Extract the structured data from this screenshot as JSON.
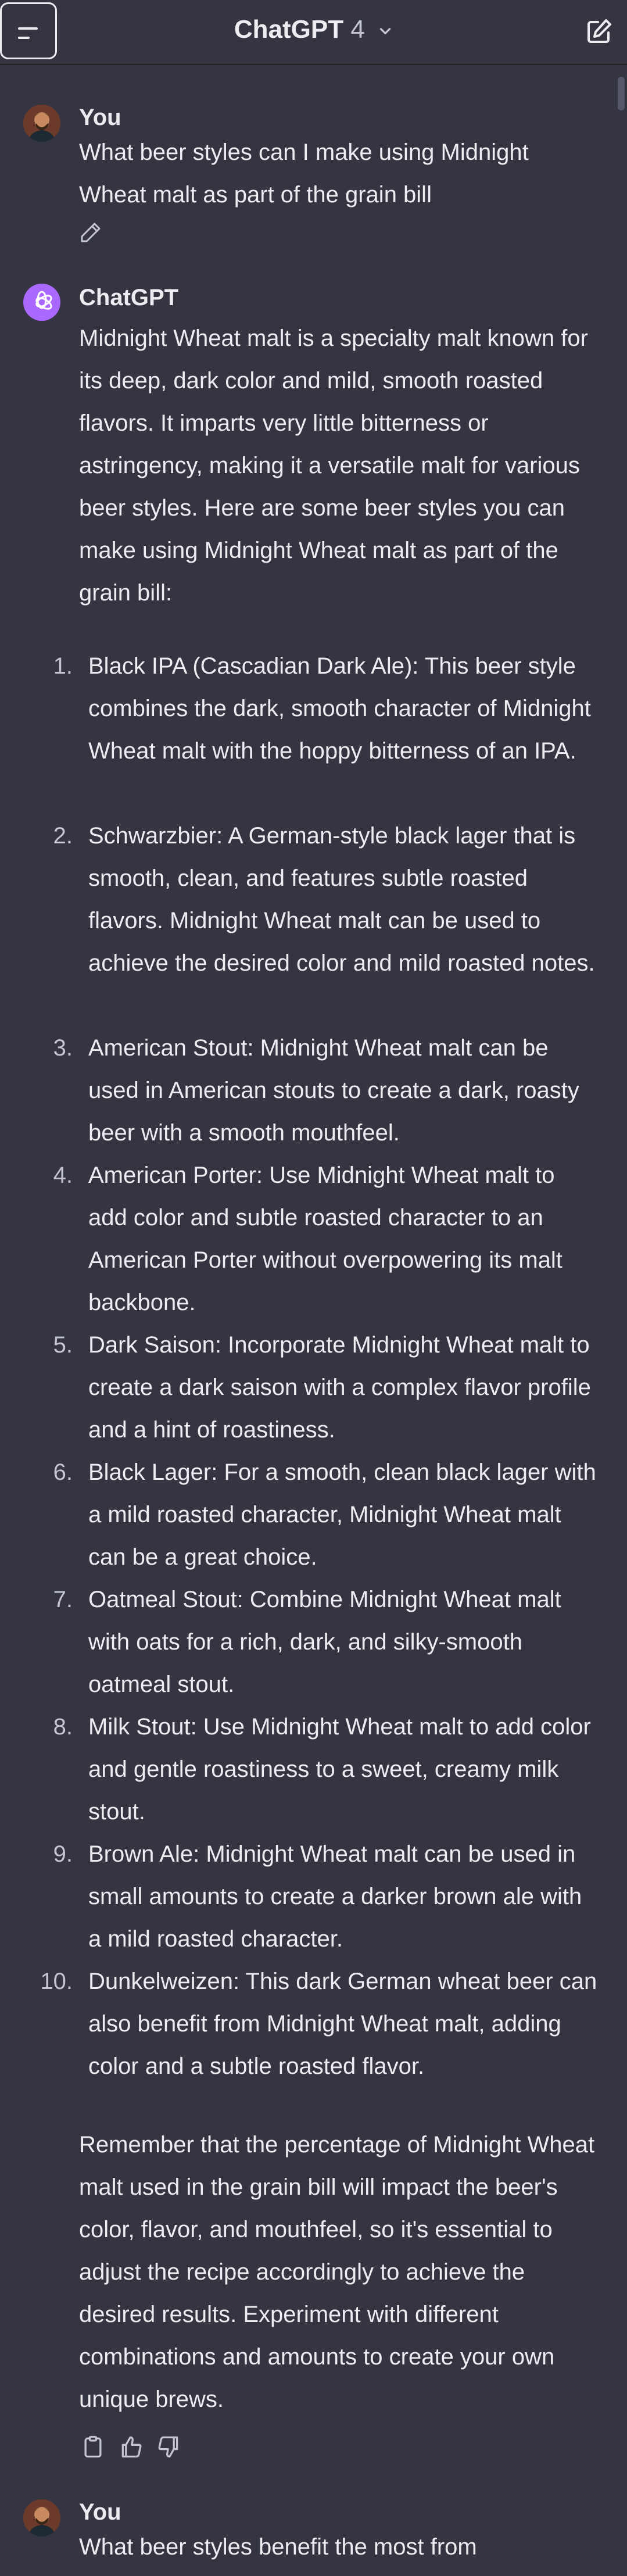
{
  "header": {
    "title": "ChatGPT",
    "model_version": "4"
  },
  "messages": [
    {
      "author": "You",
      "text": "What beer styles can I make using Midnight Wheat malt as part of the grain bill"
    },
    {
      "author": "ChatGPT",
      "intro": "Midnight Wheat malt is a specialty malt known for its deep, dark color and mild, smooth roasted flavors. It imparts very little bitterness or astringency, making it a versatile malt for various beer styles. Here are some beer styles you can make using Midnight Wheat malt as part of the grain bill:",
      "list": [
        {
          "n": "1.",
          "text": "Black IPA (Cascadian Dark Ale): This beer style combines the dark, smooth character of Midnight Wheat malt with the hoppy bitterness of an IPA."
        },
        {
          "n": "2.",
          "text": "Schwarzbier: A German-style black lager that is smooth, clean, and features subtle roasted flavors. Midnight Wheat malt can be used to achieve the desired color and mild roasted notes."
        },
        {
          "n": "3.",
          "text": "American Stout: Midnight Wheat malt can be used in American stouts to create a dark, roasty beer with a smooth mouthfeel."
        },
        {
          "n": "4.",
          "text": "American Porter: Use Midnight Wheat malt to add color and subtle roasted character to an American Porter without overpowering its malt backbone."
        },
        {
          "n": "5.",
          "text": "Dark Saison: Incorporate Midnight Wheat malt to create a dark saison with a complex flavor profile and a hint of roastiness."
        },
        {
          "n": "6.",
          "text": "Black Lager: For a smooth, clean black lager with a mild roasted character, Midnight Wheat malt can be a great choice."
        },
        {
          "n": "7.",
          "text": "Oatmeal Stout: Combine Midnight Wheat malt with oats for a rich, dark, and silky-smooth oatmeal stout."
        },
        {
          "n": "8.",
          "text": "Milk Stout: Use Midnight Wheat malt to add color and gentle roastiness to a sweet, creamy milk stout."
        },
        {
          "n": "9.",
          "text": "Brown Ale: Midnight Wheat malt can be used in small amounts to create a darker brown ale with a mild roasted character."
        },
        {
          "n": "10.",
          "text": "Dunkelweizen: This dark German wheat beer can also benefit from Midnight Wheat malt, adding color and a subtle roasted flavor."
        }
      ],
      "outro": "Remember that the percentage of Midnight Wheat malt used in the grain bill will impact the beer's color, flavor, and mouthfeel, so it's essential to adjust the recipe accordingly to achieve the desired results. Experiment with different combinations and amounts to create your own unique brews."
    },
    {
      "author": "You",
      "text": "What beer styles benefit the most from"
    }
  ],
  "icons": {
    "menu": "menu-icon",
    "chevron": "chevron-down-icon",
    "new_chat": "new-chat-icon",
    "edit": "pencil-icon",
    "copy": "clipboard-icon",
    "like": "thumbs-up-icon",
    "dislike": "thumbs-down-icon",
    "logo": "openai-logo-icon"
  },
  "colors": {
    "background": "#343541",
    "text": "#ececf1",
    "muted": "#c5c5d2",
    "gpt_accent": "#ab68ff"
  }
}
